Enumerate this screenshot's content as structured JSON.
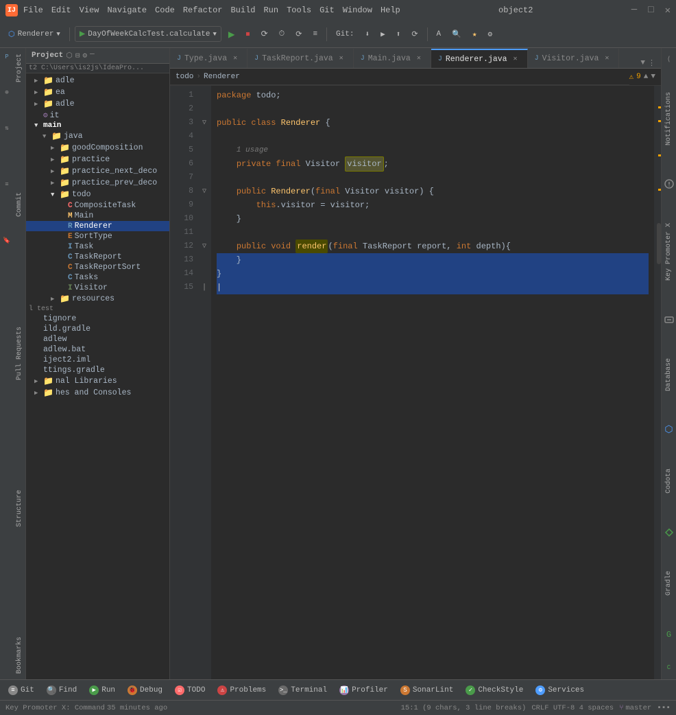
{
  "titleBar": {
    "logo": "IJ",
    "menu": [
      "File",
      "Edit",
      "View",
      "Navigate",
      "Code",
      "Refactor",
      "Build",
      "Run",
      "Tools",
      "Git",
      "Window",
      "Help"
    ],
    "windowTitle": "object2",
    "minimizeLabel": "─",
    "maximizeLabel": "□",
    "closeLabel": "✕"
  },
  "toolbar": {
    "rendererLabel": "Renderer",
    "runConfig": "DayOfWeekCalcTest.calculate",
    "gitLabel": "Git:",
    "buttons": [
      "▶",
      "⏹",
      "⟳",
      "⏱",
      "⟳",
      "≡"
    ],
    "gitButtons": [
      "⬇",
      "▶",
      "⬆",
      "⟳"
    ],
    "searchIcon": "🔍",
    "bookmarkIcon": "🔖",
    "settingsIcon": "⚙"
  },
  "projectPanel": {
    "title": "Project",
    "breadcrumb": "t2  C:\\Users\\is2js\\IdeaPro...",
    "items": [
      {
        "label": "adle",
        "indent": 0,
        "type": "folder"
      },
      {
        "label": "ea",
        "indent": 0,
        "type": "folder"
      },
      {
        "label": "adle",
        "indent": 0,
        "type": "folder"
      },
      {
        "label": "it",
        "indent": 0,
        "type": "file",
        "icon": "⚙"
      },
      {
        "label": "main",
        "indent": 0,
        "type": "folder",
        "open": true,
        "bold": true
      },
      {
        "label": "java",
        "indent": 1,
        "type": "folder"
      },
      {
        "label": "goodComposition",
        "indent": 2,
        "type": "folder"
      },
      {
        "label": "practice",
        "indent": 2,
        "type": "folder"
      },
      {
        "label": "practice_next_deco",
        "indent": 2,
        "type": "folder"
      },
      {
        "label": "practice_prev_deco",
        "indent": 2,
        "type": "folder"
      },
      {
        "label": "todo",
        "indent": 2,
        "type": "folder",
        "open": true
      },
      {
        "label": "CompositeTask",
        "indent": 3,
        "type": "class",
        "color": "pink"
      },
      {
        "label": "Main",
        "indent": 3,
        "type": "main",
        "color": "yellow"
      },
      {
        "label": "Renderer",
        "indent": 3,
        "type": "class",
        "color": "blue",
        "selected": true
      },
      {
        "label": "SortType",
        "indent": 3,
        "type": "enum",
        "color": "red"
      },
      {
        "label": "Task",
        "indent": 3,
        "type": "interface",
        "color": "blue"
      },
      {
        "label": "TaskReport",
        "indent": 3,
        "type": "class",
        "color": "blue"
      },
      {
        "label": "TaskReportSort",
        "indent": 3,
        "type": "class",
        "color": "red"
      },
      {
        "label": "Tasks",
        "indent": 3,
        "type": "class",
        "color": "blue"
      },
      {
        "label": "Visitor",
        "indent": 3,
        "type": "interface",
        "color": "green"
      },
      {
        "label": "resources",
        "indent": 2,
        "type": "folder"
      },
      {
        "label": "test",
        "indent": 0,
        "type": "section"
      },
      {
        "label": "tignore",
        "indent": 0,
        "type": "file"
      },
      {
        "label": "ild.gradle",
        "indent": 0,
        "type": "file"
      },
      {
        "label": "adlew",
        "indent": 0,
        "type": "file"
      },
      {
        "label": "adlew.bat",
        "indent": 0,
        "type": "file"
      },
      {
        "label": "iject2.iml",
        "indent": 0,
        "type": "file"
      },
      {
        "label": "ttings.gradle",
        "indent": 0,
        "type": "file"
      },
      {
        "label": "nal Libraries",
        "indent": 0,
        "type": "folder"
      },
      {
        "label": "hes and Consoles",
        "indent": 0,
        "type": "folder"
      }
    ]
  },
  "tabs": [
    {
      "label": "Type.java",
      "active": false,
      "modified": false
    },
    {
      "label": "TaskReport.java",
      "active": false,
      "modified": false
    },
    {
      "label": "Main.java",
      "active": false,
      "modified": false
    },
    {
      "label": "Renderer.java",
      "active": true,
      "modified": false
    },
    {
      "label": "Visitor.java",
      "active": false,
      "modified": false
    }
  ],
  "editor": {
    "filename": "Renderer.java",
    "warningCount": 9,
    "breadcrumb": "todo > Renderer",
    "lines": [
      {
        "num": 1,
        "code": "package todo;",
        "tokens": [
          {
            "text": "package ",
            "cls": "kw"
          },
          {
            "text": "todo",
            "cls": "plain"
          },
          {
            "text": ";",
            "cls": "plain"
          }
        ]
      },
      {
        "num": 2,
        "code": "",
        "tokens": []
      },
      {
        "num": 3,
        "code": "public class Renderer {",
        "tokens": [
          {
            "text": "public ",
            "cls": "kw"
          },
          {
            "text": "class ",
            "cls": "kw"
          },
          {
            "text": "Renderer",
            "cls": "type-name"
          },
          {
            "text": " {",
            "cls": "plain"
          }
        ]
      },
      {
        "num": 4,
        "code": "",
        "tokens": []
      },
      {
        "num": 5,
        "code": "    1 usage",
        "tokens": [
          {
            "text": "    ",
            "cls": "plain"
          },
          {
            "text": "1 usage",
            "cls": "usage-hint"
          }
        ]
      },
      {
        "num": 6,
        "code": "    private final Visitor visitor;",
        "tokens": [
          {
            "text": "    ",
            "cls": "plain"
          },
          {
            "text": "private ",
            "cls": "kw"
          },
          {
            "text": "final ",
            "cls": "kw"
          },
          {
            "text": "Visitor",
            "cls": "plain"
          },
          {
            "text": " ",
            "cls": "plain"
          },
          {
            "text": "visitor",
            "cls": "highlight-word",
            "highlight": true
          },
          {
            "text": ";",
            "cls": "plain"
          }
        ]
      },
      {
        "num": 7,
        "code": "",
        "tokens": []
      },
      {
        "num": 8,
        "code": "    public Renderer(final Visitor visitor) {",
        "tokens": [
          {
            "text": "    ",
            "cls": "plain"
          },
          {
            "text": "public ",
            "cls": "kw"
          },
          {
            "text": "Renderer",
            "cls": "type-name"
          },
          {
            "text": "(",
            "cls": "plain"
          },
          {
            "text": "final ",
            "cls": "kw"
          },
          {
            "text": "Visitor",
            "cls": "plain"
          },
          {
            "text": " visitor",
            "cls": "plain"
          },
          {
            "text": ") {",
            "cls": "plain"
          }
        ]
      },
      {
        "num": 9,
        "code": "        this.visitor = visitor;",
        "tokens": [
          {
            "text": "        ",
            "cls": "plain"
          },
          {
            "text": "this",
            "cls": "kw"
          },
          {
            "text": ".visitor = visitor;",
            "cls": "plain"
          }
        ]
      },
      {
        "num": 10,
        "code": "    }",
        "tokens": [
          {
            "text": "    }",
            "cls": "plain"
          }
        ]
      },
      {
        "num": 11,
        "code": "",
        "tokens": []
      },
      {
        "num": 12,
        "code": "    public void render(final TaskReport report, int depth){",
        "tokens": [
          {
            "text": "    ",
            "cls": "plain"
          },
          {
            "text": "public ",
            "cls": "kw"
          },
          {
            "text": "void ",
            "cls": "kw"
          },
          {
            "text": "render",
            "cls": "method",
            "highlight": true
          },
          {
            "text": "(",
            "cls": "plain"
          },
          {
            "text": "final ",
            "cls": "kw"
          },
          {
            "text": "TaskReport",
            "cls": "plain"
          },
          {
            "text": " report, ",
            "cls": "plain"
          },
          {
            "text": "int",
            "cls": "kw"
          },
          {
            "text": " depth){",
            "cls": "plain"
          }
        ]
      },
      {
        "num": 13,
        "code": "    }",
        "tokens": [
          {
            "text": "    }",
            "cls": "plain"
          }
        ]
      },
      {
        "num": 14,
        "code": "}",
        "tokens": [
          {
            "text": "}",
            "cls": "plain"
          }
        ]
      },
      {
        "num": 15,
        "code": "",
        "tokens": []
      }
    ],
    "selectedLines": [
      13,
      14,
      15
    ]
  },
  "rightSidebar": {
    "sections": [
      "Notifications",
      "Key Promoter X",
      "Database",
      "Codota",
      "Gradle"
    ]
  },
  "bottomTools": [
    {
      "label": "Git",
      "iconClass": "icon-git",
      "icon": "≡"
    },
    {
      "label": "Find",
      "iconClass": "icon-git",
      "icon": "🔍"
    },
    {
      "label": "Run",
      "iconClass": "icon-run",
      "icon": "▶"
    },
    {
      "label": "Debug",
      "iconClass": "icon-debug",
      "icon": "🐞"
    },
    {
      "label": "TODO",
      "iconClass": "icon-todo",
      "icon": "☑"
    },
    {
      "label": "Problems",
      "iconClass": "icon-problems",
      "icon": "⚠"
    },
    {
      "label": "Terminal",
      "iconClass": "icon-terminal",
      "icon": ">_"
    },
    {
      "label": "Profiler",
      "iconClass": "icon-profiler",
      "icon": "📊"
    },
    {
      "label": "SonarLint",
      "iconClass": "icon-sonar",
      "icon": "S"
    },
    {
      "label": "CheckStyle",
      "iconClass": "icon-check",
      "icon": "✓"
    },
    {
      "label": "Services",
      "iconClass": "icon-services",
      "icon": "⚙"
    }
  ],
  "statusBar": {
    "keyPromoter": "Key Promoter X: Command",
    "position": "15:1 (9 chars, 3 line breaks)",
    "encoding": "CRLF  UTF-8  4 spaces",
    "branch": "master",
    "memoryInfo": "35 minutes ago"
  },
  "leftSidebar": {
    "panels": [
      "Project",
      "Commit",
      "Pull Requests",
      "Structure",
      "Bookmarks"
    ]
  }
}
